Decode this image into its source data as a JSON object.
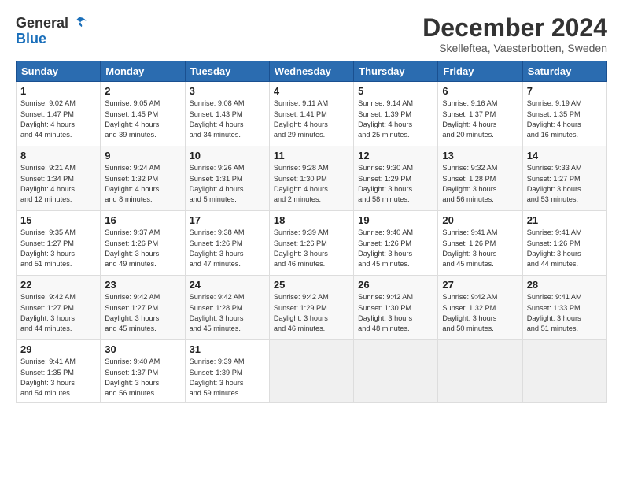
{
  "logo": {
    "general": "General",
    "blue": "Blue"
  },
  "title": "December 2024",
  "location": "Skelleftea, Vaesterbotten, Sweden",
  "headers": [
    "Sunday",
    "Monday",
    "Tuesday",
    "Wednesday",
    "Thursday",
    "Friday",
    "Saturday"
  ],
  "weeks": [
    [
      {
        "day": "1",
        "info": "Sunrise: 9:02 AM\nSunset: 1:47 PM\nDaylight: 4 hours\nand 44 minutes."
      },
      {
        "day": "2",
        "info": "Sunrise: 9:05 AM\nSunset: 1:45 PM\nDaylight: 4 hours\nand 39 minutes."
      },
      {
        "day": "3",
        "info": "Sunrise: 9:08 AM\nSunset: 1:43 PM\nDaylight: 4 hours\nand 34 minutes."
      },
      {
        "day": "4",
        "info": "Sunrise: 9:11 AM\nSunset: 1:41 PM\nDaylight: 4 hours\nand 29 minutes."
      },
      {
        "day": "5",
        "info": "Sunrise: 9:14 AM\nSunset: 1:39 PM\nDaylight: 4 hours\nand 25 minutes."
      },
      {
        "day": "6",
        "info": "Sunrise: 9:16 AM\nSunset: 1:37 PM\nDaylight: 4 hours\nand 20 minutes."
      },
      {
        "day": "7",
        "info": "Sunrise: 9:19 AM\nSunset: 1:35 PM\nDaylight: 4 hours\nand 16 minutes."
      }
    ],
    [
      {
        "day": "8",
        "info": "Sunrise: 9:21 AM\nSunset: 1:34 PM\nDaylight: 4 hours\nand 12 minutes."
      },
      {
        "day": "9",
        "info": "Sunrise: 9:24 AM\nSunset: 1:32 PM\nDaylight: 4 hours\nand 8 minutes."
      },
      {
        "day": "10",
        "info": "Sunrise: 9:26 AM\nSunset: 1:31 PM\nDaylight: 4 hours\nand 5 minutes."
      },
      {
        "day": "11",
        "info": "Sunrise: 9:28 AM\nSunset: 1:30 PM\nDaylight: 4 hours\nand 2 minutes."
      },
      {
        "day": "12",
        "info": "Sunrise: 9:30 AM\nSunset: 1:29 PM\nDaylight: 3 hours\nand 58 minutes."
      },
      {
        "day": "13",
        "info": "Sunrise: 9:32 AM\nSunset: 1:28 PM\nDaylight: 3 hours\nand 56 minutes."
      },
      {
        "day": "14",
        "info": "Sunrise: 9:33 AM\nSunset: 1:27 PM\nDaylight: 3 hours\nand 53 minutes."
      }
    ],
    [
      {
        "day": "15",
        "info": "Sunrise: 9:35 AM\nSunset: 1:27 PM\nDaylight: 3 hours\nand 51 minutes."
      },
      {
        "day": "16",
        "info": "Sunrise: 9:37 AM\nSunset: 1:26 PM\nDaylight: 3 hours\nand 49 minutes."
      },
      {
        "day": "17",
        "info": "Sunrise: 9:38 AM\nSunset: 1:26 PM\nDaylight: 3 hours\nand 47 minutes."
      },
      {
        "day": "18",
        "info": "Sunrise: 9:39 AM\nSunset: 1:26 PM\nDaylight: 3 hours\nand 46 minutes."
      },
      {
        "day": "19",
        "info": "Sunrise: 9:40 AM\nSunset: 1:26 PM\nDaylight: 3 hours\nand 45 minutes."
      },
      {
        "day": "20",
        "info": "Sunrise: 9:41 AM\nSunset: 1:26 PM\nDaylight: 3 hours\nand 45 minutes."
      },
      {
        "day": "21",
        "info": "Sunrise: 9:41 AM\nSunset: 1:26 PM\nDaylight: 3 hours\nand 44 minutes."
      }
    ],
    [
      {
        "day": "22",
        "info": "Sunrise: 9:42 AM\nSunset: 1:27 PM\nDaylight: 3 hours\nand 44 minutes."
      },
      {
        "day": "23",
        "info": "Sunrise: 9:42 AM\nSunset: 1:27 PM\nDaylight: 3 hours\nand 45 minutes."
      },
      {
        "day": "24",
        "info": "Sunrise: 9:42 AM\nSunset: 1:28 PM\nDaylight: 3 hours\nand 45 minutes."
      },
      {
        "day": "25",
        "info": "Sunrise: 9:42 AM\nSunset: 1:29 PM\nDaylight: 3 hours\nand 46 minutes."
      },
      {
        "day": "26",
        "info": "Sunrise: 9:42 AM\nSunset: 1:30 PM\nDaylight: 3 hours\nand 48 minutes."
      },
      {
        "day": "27",
        "info": "Sunrise: 9:42 AM\nSunset: 1:32 PM\nDaylight: 3 hours\nand 50 minutes."
      },
      {
        "day": "28",
        "info": "Sunrise: 9:41 AM\nSunset: 1:33 PM\nDaylight: 3 hours\nand 51 minutes."
      }
    ],
    [
      {
        "day": "29",
        "info": "Sunrise: 9:41 AM\nSunset: 1:35 PM\nDaylight: 3 hours\nand 54 minutes."
      },
      {
        "day": "30",
        "info": "Sunrise: 9:40 AM\nSunset: 1:37 PM\nDaylight: 3 hours\nand 56 minutes."
      },
      {
        "day": "31",
        "info": "Sunrise: 9:39 AM\nSunset: 1:39 PM\nDaylight: 3 hours\nand 59 minutes."
      },
      null,
      null,
      null,
      null
    ]
  ]
}
